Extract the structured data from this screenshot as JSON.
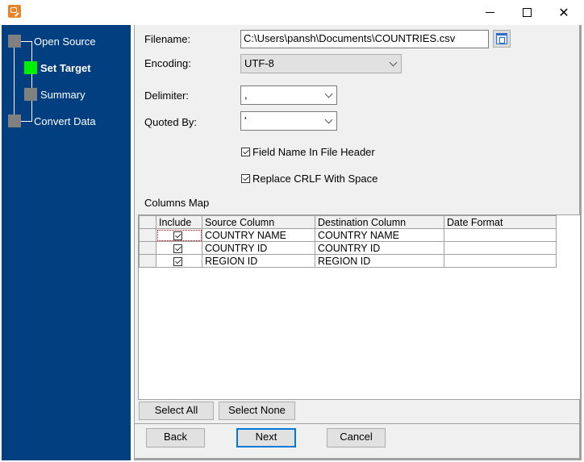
{
  "window": {
    "app_icon": "database-edit-icon",
    "controls": {
      "minimize": "minimize-icon",
      "maximize": "maximize-icon",
      "close": "close-icon"
    }
  },
  "sidebar": {
    "steps": [
      {
        "label": "Open Source",
        "state": "done"
      },
      {
        "label": "Set Target",
        "state": "active"
      },
      {
        "label": "Summary",
        "state": "pending"
      },
      {
        "label": "Convert Data",
        "state": "pending"
      }
    ],
    "background": "#013f80",
    "active_color": "#00ee00"
  },
  "form": {
    "filename_label": "Filename:",
    "filename_value": "C:\\Users\\pansh\\Documents\\COUNTRIES.csv",
    "encoding_label": "Encoding:",
    "encoding_value": "UTF-8",
    "delimiter_label": "Delimiter:",
    "delimiter_value": ",",
    "quoted_by_label": "Quoted By:",
    "quoted_by_value": "'",
    "field_name_header_label": "Field Name In File Header",
    "field_name_header_checked": true,
    "replace_crlf_label": "Replace CRLF With Space",
    "replace_crlf_checked": true
  },
  "columns_map": {
    "title": "Columns Map",
    "headers": [
      "Include",
      "Source Column",
      "Destination Column",
      "Date Format"
    ],
    "rows": [
      {
        "include": true,
        "source": "COUNTRY NAME",
        "destination": "COUNTRY NAME",
        "date_format": ""
      },
      {
        "include": true,
        "source": "COUNTRY ID",
        "destination": "COUNTRY ID",
        "date_format": ""
      },
      {
        "include": true,
        "source": "REGION ID",
        "destination": "REGION ID",
        "date_format": ""
      }
    ],
    "select_all_label": "Select All",
    "select_none_label": "Select None"
  },
  "nav": {
    "back_label": "Back",
    "next_label": "Next",
    "cancel_label": "Cancel"
  }
}
